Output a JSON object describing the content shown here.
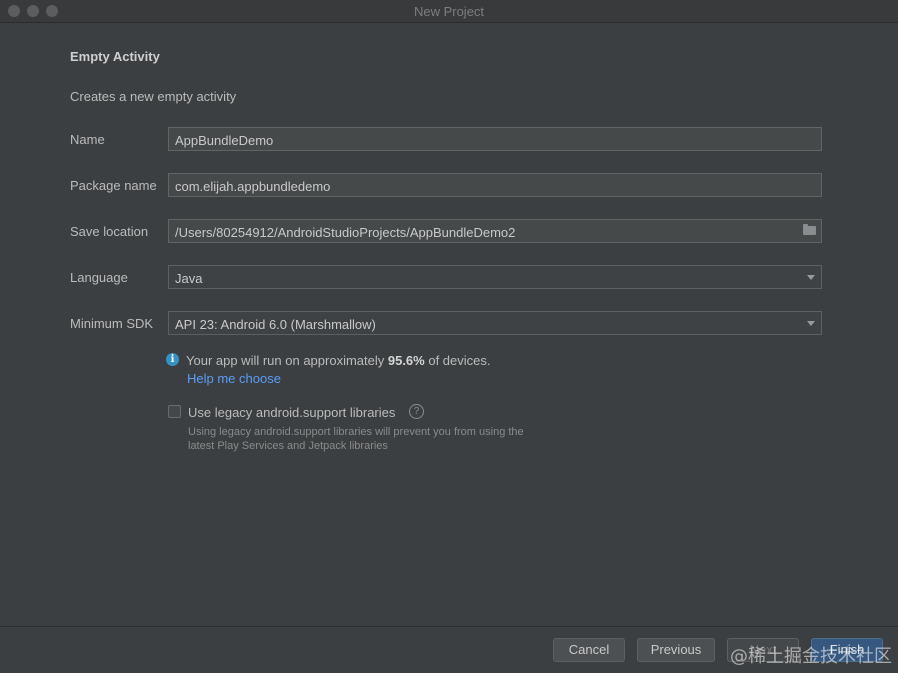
{
  "window": {
    "title": "New Project"
  },
  "heading": "Empty Activity",
  "subheading": "Creates a new empty activity",
  "form": {
    "name_label": "Name",
    "name_value": "AppBundleDemo",
    "package_label": "Package name",
    "package_value": "com.elijah.appbundledemo",
    "save_label": "Save location",
    "save_value": "/Users/80254912/AndroidStudioProjects/AppBundleDemo2",
    "language_label": "Language",
    "language_value": "Java",
    "sdk_label": "Minimum SDK",
    "sdk_value": "API 23: Android 6.0 (Marshmallow)"
  },
  "info": {
    "prefix": "Your app will run on approximately ",
    "percent": "95.6%",
    "suffix": " of devices.",
    "help_link": "Help me choose"
  },
  "legacy": {
    "label": "Use legacy android.support libraries",
    "hint_line1": "Using legacy android.support libraries will prevent you from using the",
    "hint_line2": "latest Play Services and Jetpack libraries"
  },
  "buttons": {
    "cancel": "Cancel",
    "previous": "Previous",
    "next": "Next",
    "finish": "Finish"
  },
  "watermark": "@稀土掘金技术社区",
  "icons": {
    "info": "info-icon",
    "help": "question-icon",
    "folder": "folder-icon",
    "dropdown": "chevron-down-icon"
  },
  "colors": {
    "background": "#3c3f41",
    "link": "#589df6",
    "primary_button": "#365880",
    "info_icon": "#3592c4"
  }
}
